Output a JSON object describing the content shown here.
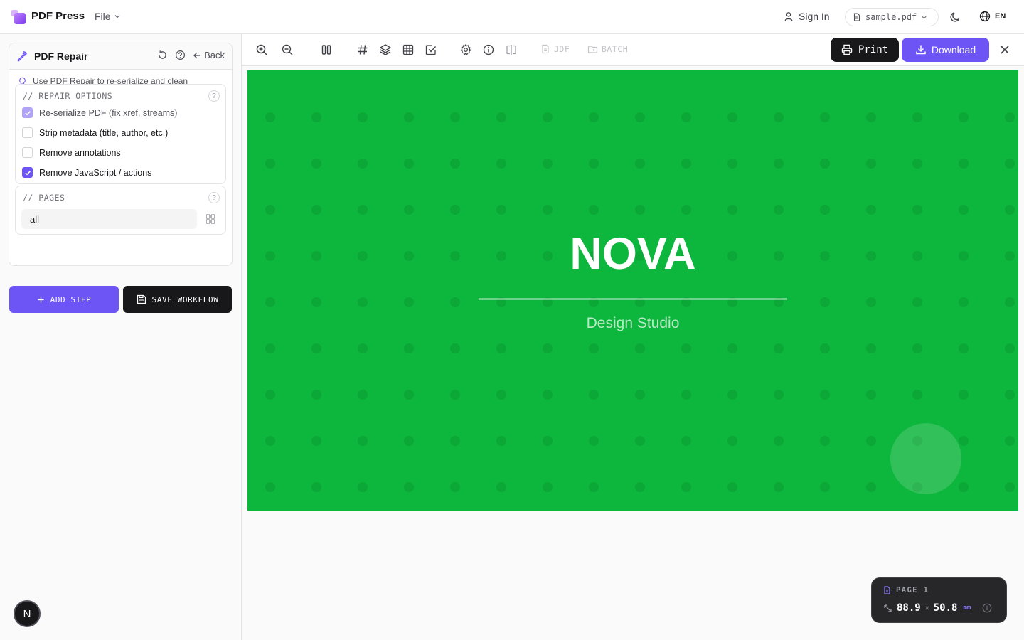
{
  "app": {
    "brand": "PDF Press",
    "file_menu": "File",
    "sign_in": "Sign In",
    "file_name": "sample.pdf",
    "language": "EN"
  },
  "sidebar": {
    "tool_title": "PDF Repair",
    "back_label": "Back",
    "tip": "Use PDF Repair to re-serialize and clean damaged PDFs.",
    "repair_options_label": "// REPAIR OPTIONS",
    "options": [
      {
        "label": "Re-serialize PDF (fix xref, streams)",
        "checked": true,
        "disabled": true
      },
      {
        "label": "Strip metadata (title, author, etc.)",
        "checked": false,
        "disabled": false
      },
      {
        "label": "Remove annotations",
        "checked": false,
        "disabled": false
      },
      {
        "label": "Remove JavaScript / actions",
        "checked": true,
        "disabled": false
      }
    ],
    "pages_label": "// PAGES",
    "pages_value": "all",
    "add_step_label": "ADD STEP",
    "save_workflow_label": "SAVE WORKFLOW",
    "avatar_letter": "N"
  },
  "toolbar": {
    "jdf_label": "JDF",
    "batch_label": "BATCH",
    "print_label": "Print",
    "download_label": "Download"
  },
  "document": {
    "heading": "NOVA",
    "subheading": "Design Studio",
    "background_color": "#0db63c"
  },
  "page_info": {
    "label": "PAGE 1",
    "width": "88.9",
    "height": "50.8",
    "separator": "×",
    "unit": "mm"
  },
  "colors": {
    "accent": "#6d55f5",
    "dark": "#18181b"
  }
}
